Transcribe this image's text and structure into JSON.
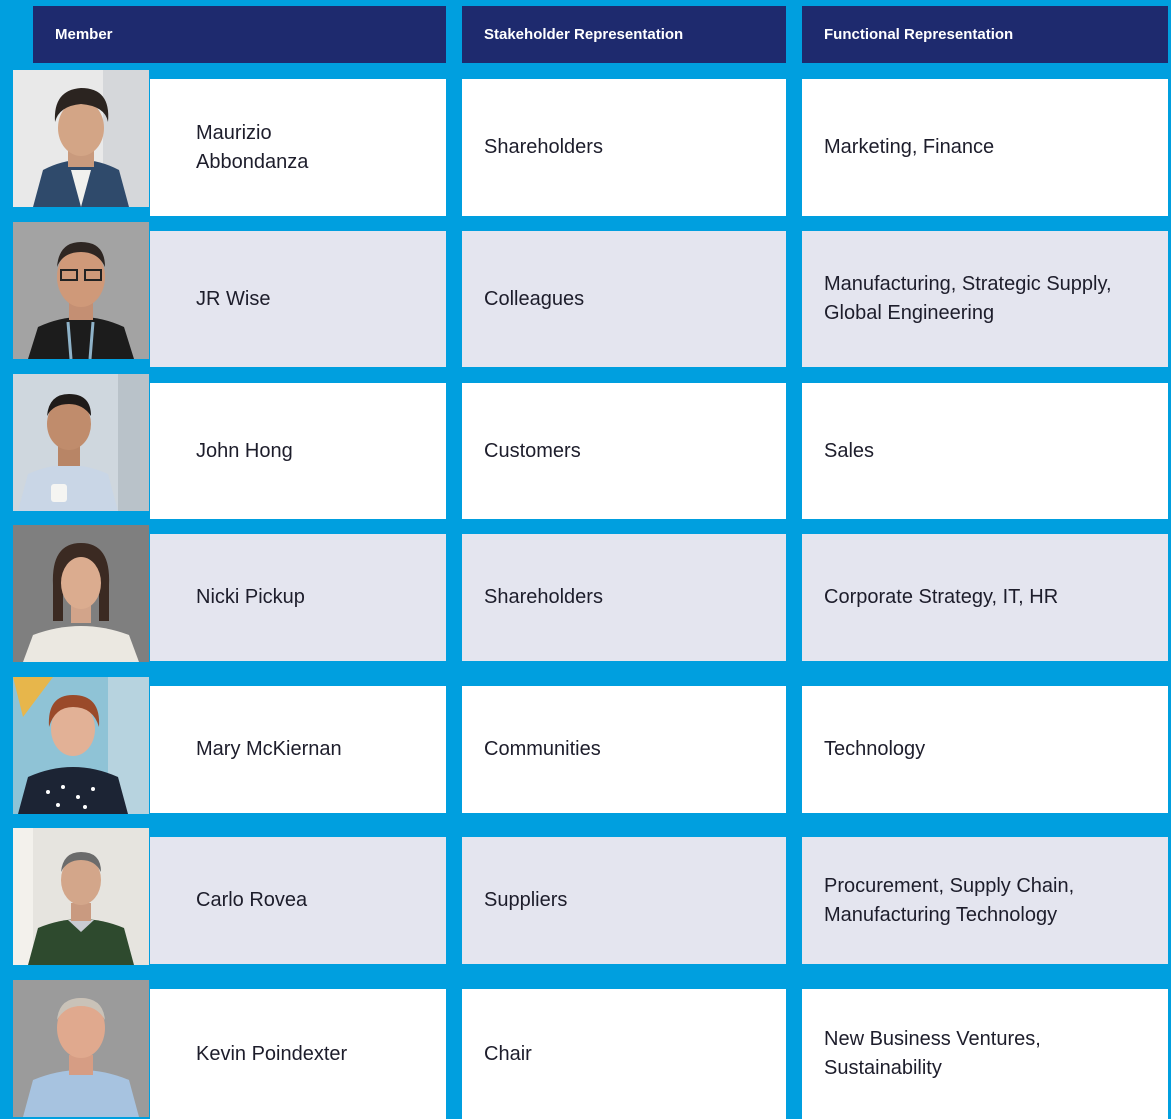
{
  "headers": {
    "member": "Member",
    "stakeholder": "Stakeholder Representation",
    "functional": "Functional Representation"
  },
  "rows": [
    {
      "name": "Maurizio Abbondanza",
      "stakeholder": "Shareholders",
      "functional": "Marketing, Finance"
    },
    {
      "name": "JR Wise",
      "stakeholder": "Colleagues",
      "functional": "Manufacturing, Strategic Supply, Global Engineering"
    },
    {
      "name": "John Hong",
      "stakeholder": "Customers",
      "functional": "Sales"
    },
    {
      "name": "Nicki Pickup",
      "stakeholder": "Shareholders",
      "functional": "Corporate Strategy, IT, HR"
    },
    {
      "name": "Mary McKiernan",
      "stakeholder": "Communities",
      "functional": "Technology"
    },
    {
      "name": "Carlo Rovea",
      "stakeholder": "Suppliers",
      "functional": "Procurement, Supply Chain, Manufacturing Technology"
    },
    {
      "name": "Kevin Poindexter",
      "stakeholder": "Chair",
      "functional": "New Business Ventures, Sustainability"
    }
  ],
  "colors": {
    "background": "#009fdf",
    "header": "#1e2a6e",
    "row_white": "#ffffff",
    "row_grey": "#e4e5ef"
  }
}
